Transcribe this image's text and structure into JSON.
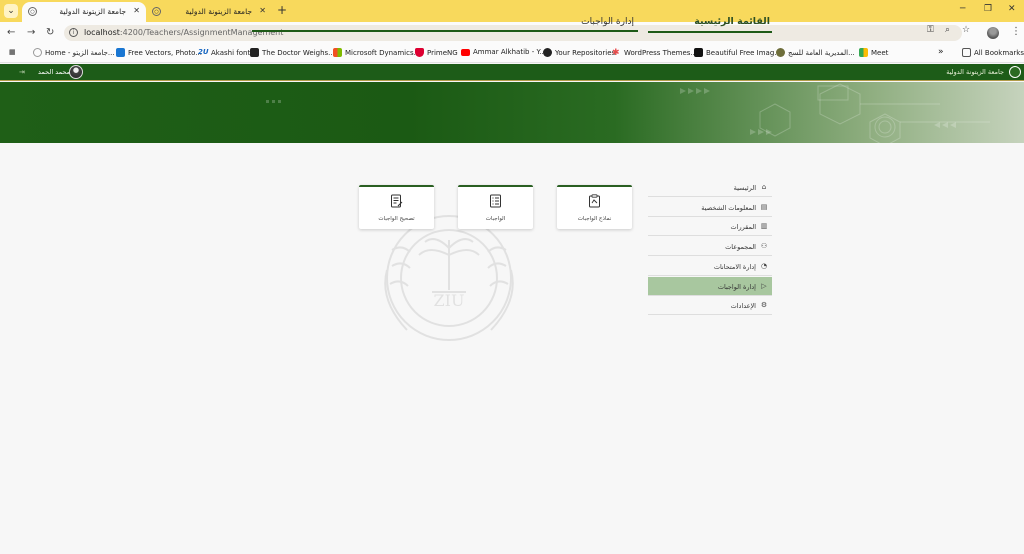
{
  "browser": {
    "tabs": [
      {
        "title": "جامعة الزيتونة الدولية",
        "active": true
      },
      {
        "title": "جامعة الزيتونة الدولية",
        "active": false
      }
    ],
    "url_host": "localhost",
    "url_path": ":4200/Teachers/AssignmentManagement",
    "bookmarks": [
      {
        "label": "Home - جامعة الزيتو..."
      },
      {
        "label": "Free Vectors, Photo..."
      },
      {
        "label": "Akashi font"
      },
      {
        "label": "The Doctor Weighs..."
      },
      {
        "label": "Microsoft Dynamics..."
      },
      {
        "label": "PrimeNG"
      },
      {
        "label": "Ammar Alkhatib - Y..."
      },
      {
        "label": "Your Repositories"
      },
      {
        "label": "WordPress Themes..."
      },
      {
        "label": "Beautiful Free Imag..."
      },
      {
        "label": "المديرية العامة للسج..."
      },
      {
        "label": "Meet"
      }
    ],
    "all_bookmarks": "All Bookmarks",
    "overflow": "»"
  },
  "header": {
    "university_name": "جامعة الزيتونة الدولية",
    "user_name": "محمد الحمد"
  },
  "sidebar": {
    "title": "القائمة الرئيسية",
    "items": [
      {
        "label": "الرئيسية",
        "icon": "home-icon",
        "glyph": "⌂"
      },
      {
        "label": "المعلومات الشخصية",
        "icon": "id-card-icon",
        "glyph": "▤"
      },
      {
        "label": "المقررات",
        "icon": "books-icon",
        "glyph": "▥"
      },
      {
        "label": "المجموعات",
        "icon": "group-icon",
        "glyph": "⚇"
      },
      {
        "label": "إدارة الامتحانات",
        "icon": "exam-icon",
        "glyph": "◔"
      },
      {
        "label": "إدارة الواجبات",
        "icon": "play-icon",
        "glyph": "▷",
        "active": true
      },
      {
        "label": "الإعدادات",
        "icon": "gear-icon",
        "glyph": "⚙"
      }
    ]
  },
  "main": {
    "title": "إدارة الواجبات",
    "cards": [
      {
        "label": "نماذج الواجبات",
        "icon": "clipboard-icon"
      },
      {
        "label": "الواجبات",
        "icon": "checklist-icon"
      },
      {
        "label": "تصحيح الواجبات",
        "icon": "grading-icon"
      }
    ]
  },
  "watermark_text": "ZIU"
}
